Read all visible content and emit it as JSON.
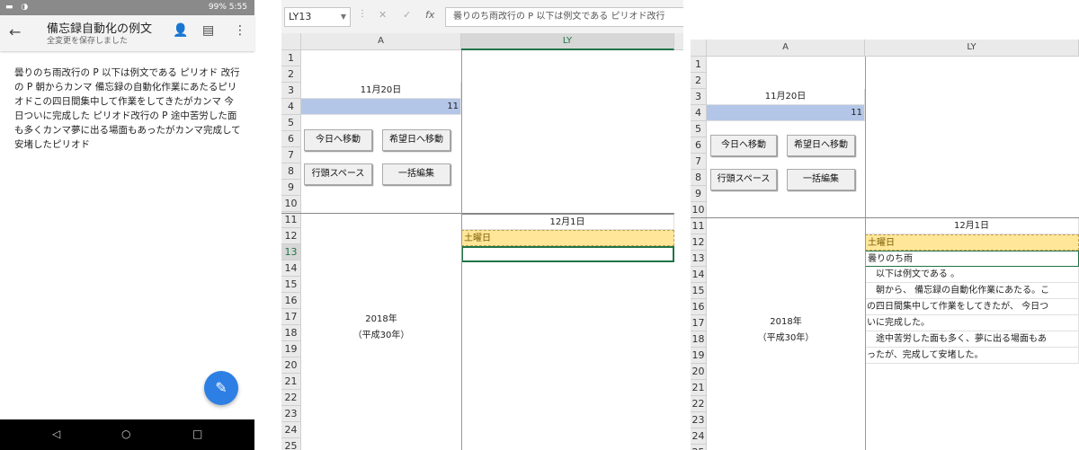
{
  "phone": {
    "status_right": "99% 5:55",
    "title": "備忘録自動化の例文",
    "subtitle": "全変更を保存しました",
    "body": "曇りのち雨改行の P 以下は例文である ピリオド 改行の P 朝からカンマ 備忘録の自動化作業にあたるピリオドこの四日間集中して作業をしてきたがカンマ 今日ついに完成した ピリオド改行の P 途中苦労した面も多くカンマ夢に出る場面もあったがカンマ完成して安堵したピリオド"
  },
  "excel1": {
    "namebox": "LY13",
    "formula": "曇りのち雨改行の P 以下は例文である ピリオド改行",
    "col_a": "A",
    "col_ly": "LY",
    "rows": [
      "1",
      "2",
      "3",
      "4",
      "5",
      "6",
      "7",
      "8",
      "9",
      "10",
      "11",
      "12",
      "13",
      "14",
      "15",
      "16",
      "17",
      "18",
      "19",
      "20",
      "21",
      "22",
      "23",
      "24",
      "25"
    ],
    "date_nov": "11月20日",
    "val_11": "11",
    "btn_today": "今日へ移動",
    "btn_desired": "希望日へ移動",
    "btn_indent": "行頭スペース",
    "btn_bulk": "一括編集",
    "date_dec": "12月1日",
    "weekday": "土曜日",
    "year": "2018年",
    "era": "（平成30年）"
  },
  "excel2": {
    "col_a": "A",
    "col_ly": "LY",
    "date_nov": "11月20日",
    "val_11": "11",
    "btn_today": "今日へ移動",
    "btn_desired": "希望日へ移動",
    "btn_indent": "行頭スペース",
    "btn_bulk": "一括編集",
    "date_dec": "12月1日",
    "weekday": "土曜日",
    "year": "2018年",
    "era": "（平成30年）",
    "lines": [
      "曇りのち雨",
      "　以下は例文である 。",
      "　朝から、 備忘録の自動化作業にあたる。こ",
      "の四日間集中して作業をしてきたが、 今日つ",
      "いに完成した。",
      "　途中苦労した面も多く、夢に出る場面もあ",
      "ったが、完成して安堵した。"
    ]
  }
}
